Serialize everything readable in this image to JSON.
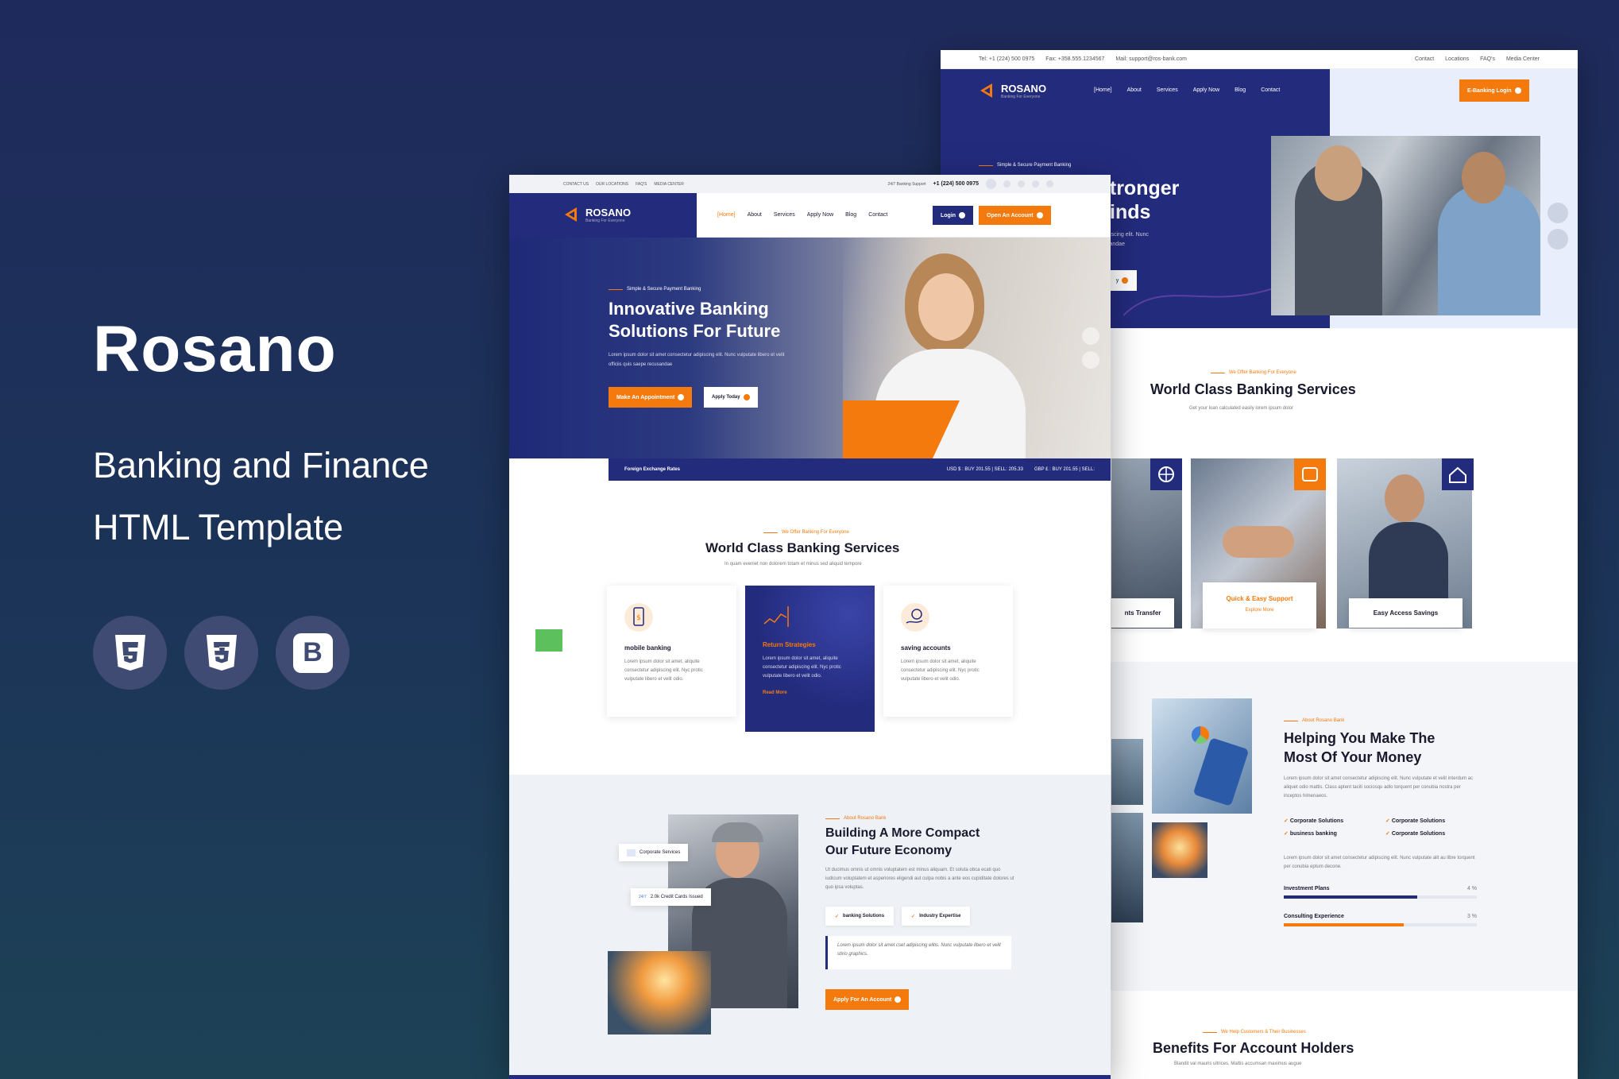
{
  "promo": {
    "title": "Rosano",
    "subtitle_line1": "Banking and Finance",
    "subtitle_line2": "HTML Template",
    "badges": [
      {
        "icon": "html5-icon"
      },
      {
        "icon": "css3-icon"
      },
      {
        "icon": "bootstrap-icon",
        "glyph": "B"
      }
    ]
  },
  "colors": {
    "navy": "#232b7d",
    "orange": "#f47a0d",
    "bg": "#1f2a5c"
  },
  "shotA": {
    "topbar": {
      "tel": "Tel: +1 (224) 500 0975",
      "fax": "Fax: +358.555.1234567",
      "mail": "Mail: support@ros-bank.com",
      "links": [
        "Contact",
        "Locations",
        "FAQ's",
        "Media Center"
      ]
    },
    "brand": {
      "name": "ROSANO",
      "tagline": "Banking For Everyone"
    },
    "nav": [
      "[Home]",
      "About",
      "Services",
      "Apply Now",
      "Blog",
      "Contact"
    ],
    "login_btn": "E-Banking Login",
    "hero": {
      "tag": "Simple & Secure Payment Banking",
      "title_line1": "We Develop Stronger",
      "title_line2": "inds",
      "desc_line1": "piscing elit. Nunc",
      "desc_line2": "sandae",
      "btn": "y"
    },
    "services": {
      "tag": "We Offer Banking For Everyone",
      "title": "World Class Banking Services",
      "desc": "Get your loan calculated easily lorem ipsum dolor",
      "cards": [
        {
          "label": "nts Transfer"
        },
        {
          "label": "Quick & Easy Support",
          "link": "Explore More"
        },
        {
          "label": "Easy Access Savings"
        }
      ]
    },
    "about": {
      "tag": "About Rosano Bank",
      "title_line1": "Helping You Make The",
      "title_line2": "Most Of Your Money",
      "desc": "Lorem ipsum dolor sit amet consectetur adipiscing elit. Nunc vulputate et velit interdum ac aliquet odio mattis. Class aptent taciti sociosqu adlo torquent per conubia nostra per inceptos himenaeos.",
      "checks": [
        "Corporate Solutions",
        "Corporate Solutions",
        "business banking",
        "Corporate Solutions"
      ],
      "desc2": "Lorem ipsum dolor sit amet consectetur adipiscing elit. Nunc vulputate alit au libre torquent per conubia eptum decone.",
      "progress": [
        {
          "label": "Investment Plans",
          "value_text": "4 %",
          "fill": 0.69
        },
        {
          "label": "Consulting Experience",
          "value_text": "3 %",
          "fill": 0.62
        }
      ]
    },
    "benefits": {
      "tag": "We Help Customers & Their Businesses",
      "title": "Benefits For Account Holders",
      "desc": "Blandit val mauris ultrices. Mattis accumsan maximus augue"
    }
  },
  "shotB": {
    "topbar": {
      "links": [
        "CONTACT US",
        "OUR LOCATIONS",
        "FAQ'S",
        "MEDIA CENTER"
      ],
      "support": "24/7 Banking Support",
      "phone": "+1 (224) 500 0975"
    },
    "brand": {
      "name": "ROSANO",
      "tagline": "Banking For Everyone"
    },
    "nav": [
      "[Home]",
      "About",
      "Services",
      "Apply Now",
      "Blog",
      "Contact"
    ],
    "login_btn": "Login",
    "open_btn": "Open An Account",
    "hero": {
      "tag": "Simple & Secure Payment Banking",
      "title_line1": "Innovative Banking",
      "title_line2": "Solutions For Future",
      "desc": "Lorem ipsum dolor sit amet consectetur adipiscing elit. Nunc vulputate libero et velit officiis quis saepe recusandae",
      "btn1": "Make An Appointment",
      "btn2": "Apply Today"
    },
    "rates": {
      "label": "Foreign Exchange Rates",
      "usd": "USD $ : BUY 201.55 | SELL: 205.33",
      "gbp": "GBP £ : BUY 201.55 | SELL:"
    },
    "services": {
      "tag": "We Offer Banking For Everyone",
      "title": "World Class Banking Services",
      "desc": "In quam eveniet non dolorem totam et minus sed aliquid tempore",
      "cards": [
        {
          "title": "mobile banking",
          "text": "Lorem ipsum dolor sit amet, aliquite consectetur adipiscing elit. Nyc protic vulputate libero et velit odio.",
          "icon": "mobile-payment-icon"
        },
        {
          "title": "Return Strategies",
          "text": "Lorem ipsum dolor sit amet, aliquite consectetur adipiscing elit. Nyc protic vulputate libero et velit odio.",
          "icon": "chart-icon",
          "link": "Read More"
        },
        {
          "title": "saving accounts",
          "text": "Lorem ipsum dolor sit amet, aliquite consectetur adipiscing elit. Nyc protic vulputate libero et velit odio.",
          "icon": "hand-coin-icon"
        }
      ]
    },
    "about": {
      "tag": "About Rosano Bank",
      "title_line1": "Building A More Compact",
      "title_line2": "Our Future Economy",
      "desc": "Ut ducimus omnis ut omnis voluptatem est minus aliquam. Et soluta obca ecati quo iudicum voluptatem et asperiores eligendi aut culpa nobis a ante eos cupiditate dolores ut quo ipsa voluptas.",
      "chips": [
        "banking Solutions",
        "Industry Expertise"
      ],
      "quote": "Lorem ipsum dolor sit amet cset adipiscing elitis. Nunc vulputate libero et velit stirio graphics.",
      "btn": "Apply For An Account",
      "float1": "Corporate Services",
      "float2": "2.0k Credit Cards Issued",
      "float2_icon": "24/7"
    }
  }
}
